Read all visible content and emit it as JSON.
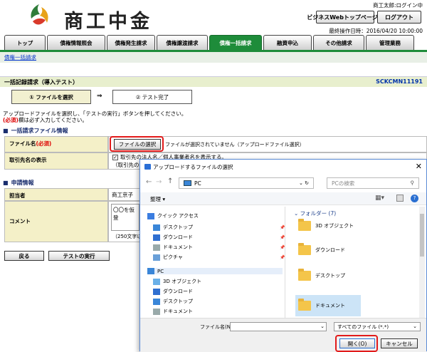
{
  "header": {
    "logo_text": "商工中金",
    "user": "商工太郎:ログイン中",
    "site_button": "ビジネスWebトップページへ",
    "logout_button": "ログアウト",
    "last_operation": "最終操作日時：2016/04/20 10:00:00"
  },
  "tabs": [
    "トップ",
    "債権情報照会",
    "債権発生請求",
    "債権譲渡請求",
    "債権一括請求",
    "融資申込",
    "その他請求",
    "管理業務"
  ],
  "active_tab": "債権一括請求",
  "breadcrumb": "債権一括請求",
  "page": {
    "title": "一括記録請求（導入テスト）",
    "screen_id": "SCKCMN11191"
  },
  "steps": {
    "step1": "① ファイルを選択",
    "arrow": "⇒",
    "step2": "② テスト完了"
  },
  "instructions": {
    "line1": "アップロードファイルを選択し、「テストの実行」ボタンを押してください。",
    "required_mark": "(必須)",
    "line2": "欄は必ず入力してください。"
  },
  "upload_section": {
    "heading": "一括請求ファイル情報",
    "file_label": "ファイル名",
    "file_required": "(必須)",
    "file_button": "ファイルの選択",
    "file_status": "ファイルが選択されていません（アップロードファイル選択）",
    "counterparty_label": "取引先名の表示",
    "counterparty_checkbox": "取引先の法人名／個人事業者名を表示する。",
    "counterparty_note": "（取引先の法"
  },
  "applicant_section": {
    "heading": "申請情報",
    "person_label": "担当者",
    "person_value": "商工京子",
    "comment_label": "コメント",
    "comment_value": "〇〇を仮登",
    "comment_limit": "（250文字以"
  },
  "buttons": {
    "back": "戻る",
    "run_test": "テストの実行"
  },
  "dialog": {
    "title": "アップロードするファイルの選択",
    "close": "✕",
    "path": "PC",
    "search_placeholder": "PCの検索",
    "organize": "整理 ▾",
    "nav_items": [
      {
        "label": "クイック アクセス",
        "icon": "star-icon"
      },
      {
        "label": "デスクトップ",
        "icon": "desktop-icon"
      },
      {
        "label": "ダウンロード",
        "icon": "download-icon"
      },
      {
        "label": "ドキュメント",
        "icon": "document-icon"
      },
      {
        "label": "ピクチャ",
        "icon": "picture-icon"
      },
      {
        "label": "PC",
        "icon": "pc-icon"
      },
      {
        "label": "3D オブジェクト",
        "icon": "cube-icon"
      },
      {
        "label": "ダウンロード",
        "icon": "download-icon"
      },
      {
        "label": "デスクトップ",
        "icon": "desktop-icon"
      },
      {
        "label": "ドキュメント",
        "icon": "document-icon"
      }
    ],
    "folder_group": "フォルダー (7)",
    "folders": [
      "3D オブジェクト",
      "ダウンロード",
      "デスクトップ",
      "ドキュメント"
    ],
    "filename_label": "ファイル名(N):",
    "filetype": "すべてのファイル (*.*)",
    "open_button": "開く(O)",
    "cancel_button": "キャンセル"
  },
  "colors": {
    "accent": "#1e8c3a",
    "highlight": "#e21b1b",
    "section": "#1a2e6e"
  }
}
